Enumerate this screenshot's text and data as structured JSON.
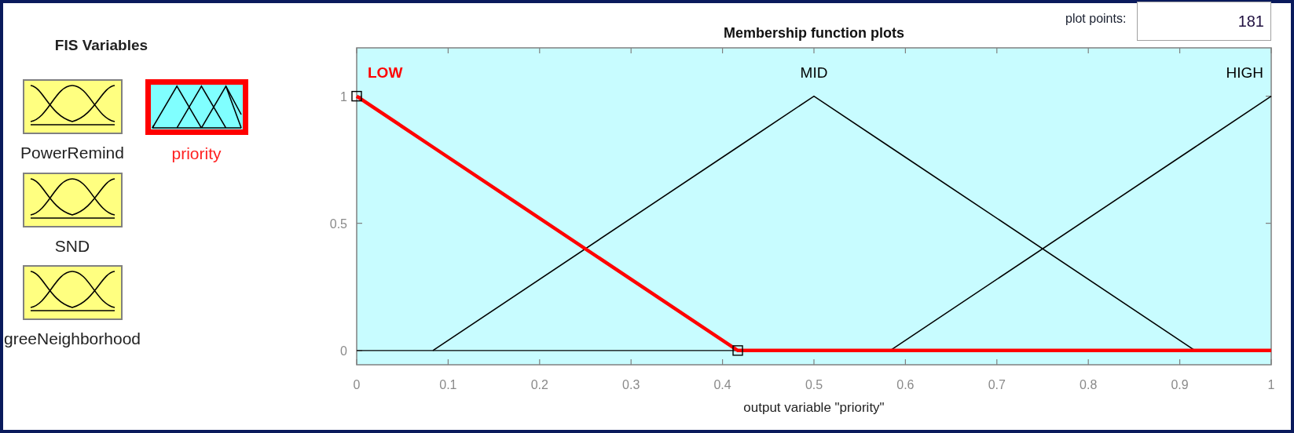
{
  "fis_variables": {
    "title": "FIS Variables",
    "variables": [
      {
        "name": "PowerRemind",
        "kind": "input",
        "selected": false
      },
      {
        "name": "priority",
        "kind": "output",
        "selected": true
      },
      {
        "name": "SND",
        "kind": "input",
        "selected": false
      },
      {
        "name": "greeNeighborhood",
        "kind": "input",
        "selected": false
      }
    ]
  },
  "plot_points": {
    "label": "plot points:",
    "value": "181"
  },
  "membership_plot": {
    "chart_data": {
      "type": "line",
      "title": "Membership function plots",
      "xlabel": "output variable \"priority\"",
      "x": [
        0,
        0.0833,
        0.4167,
        0.5,
        0.5833,
        0.9167,
        1
      ],
      "series": [
        {
          "name": "LOW",
          "color": "#ff0000",
          "values": [
            1,
            0.8,
            0,
            0,
            0,
            0,
            0
          ]
        },
        {
          "name": "MID",
          "color": "#000000",
          "values": [
            null,
            0,
            0.8,
            1,
            0.8,
            0,
            null
          ]
        },
        {
          "name": "HIGH",
          "color": "#000000",
          "values": [
            null,
            null,
            null,
            null,
            0,
            0.8,
            1
          ]
        }
      ],
      "xlim": [
        0,
        1
      ],
      "ylim": [
        -0.056,
        1.19
      ],
      "xticks": [
        0,
        0.1,
        0.2,
        0.3,
        0.4,
        0.5,
        0.6,
        0.7,
        0.8,
        0.9,
        1
      ],
      "yticks": [
        0,
        0.5,
        1
      ]
    },
    "functions": [
      {
        "selected": true
      },
      {
        "selected": false
      },
      {
        "selected": false
      }
    ]
  }
}
